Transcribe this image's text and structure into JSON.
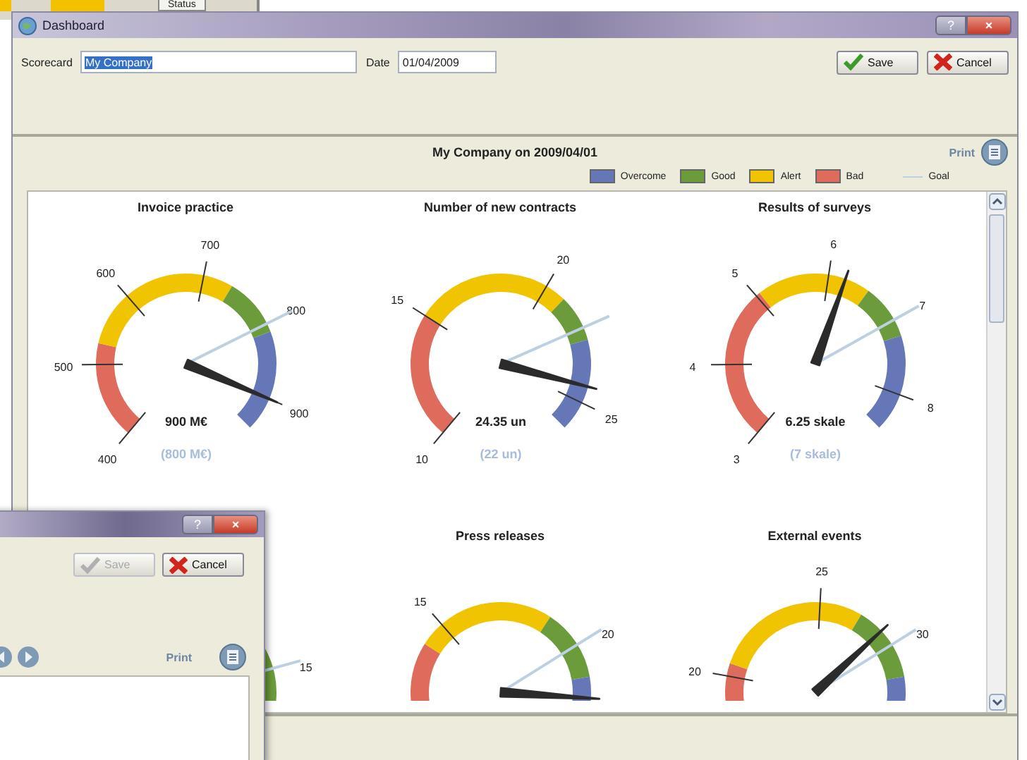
{
  "background_app": {
    "tab": "Status"
  },
  "window": {
    "title": "Dashboard",
    "help": "?",
    "close": "×"
  },
  "toolbar": {
    "fields": [
      {
        "label": "Scorecard",
        "value": "My Company",
        "selected": true
      },
      {
        "label": "Date",
        "value": "01/04/2009",
        "selected": false
      }
    ],
    "buttons": [
      {
        "label": "Save",
        "kind": "save",
        "disabled": false
      },
      {
        "label": "Cancel",
        "kind": "cancel",
        "disabled": false
      }
    ]
  },
  "panel": {
    "title": "My Company on 2009/04/01",
    "print": "Print",
    "legend": [
      {
        "label": "Overcome",
        "kind": "swatch",
        "color": "#6677b8"
      },
      {
        "label": "Good",
        "kind": "swatch",
        "color": "#6b9b3a"
      },
      {
        "label": "Alert",
        "kind": "swatch",
        "color": "#f0c400"
      },
      {
        "label": "Bad",
        "kind": "swatch",
        "color": "#df6b5c"
      },
      {
        "label": "Goal",
        "kind": "line",
        "color": "#bcd0e2"
      }
    ],
    "gauges": [
      {
        "title": "Invoice practice",
        "value_label": "900 M€",
        "goal_label": "(800 M€)",
        "ticks": [
          "400",
          "500",
          "600",
          "700",
          "800",
          "900"
        ]
      },
      {
        "title": "Number of new contracts",
        "value_label": "24.35 un",
        "goal_label": "(22 un)",
        "ticks": [
          "10",
          "15",
          "20",
          "25"
        ]
      },
      {
        "title": "Results of surveys",
        "value_label": "6.25 skale",
        "goal_label": "(7 skale)",
        "ticks": [
          "3",
          "4",
          "5",
          "6",
          "7",
          "8"
        ]
      },
      {
        "ticks": [
          "15"
        ]
      },
      {
        "title": "Press releases",
        "ticks": [
          "15",
          "20"
        ]
      },
      {
        "title": "External events",
        "ticks": [
          "20",
          "25",
          "30"
        ]
      }
    ]
  },
  "dialog": {
    "help": "?",
    "close": "×",
    "buttons": [
      {
        "label": "Save",
        "kind": "save",
        "disabled": true
      },
      {
        "label": "Cancel",
        "kind": "cancel",
        "disabled": false
      }
    ],
    "print": "Print"
  }
}
